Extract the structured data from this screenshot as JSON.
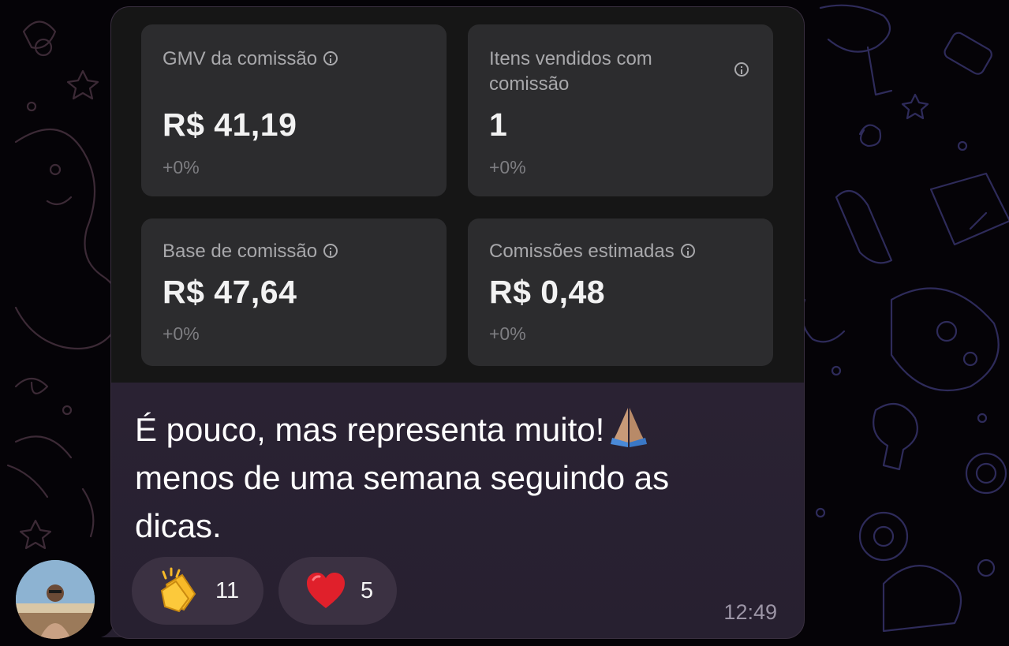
{
  "cards": [
    {
      "label": "GMV da comissão",
      "value": "R$ 41,19",
      "delta": "+0%"
    },
    {
      "label_line1": "Itens vendidos com",
      "label_line2": "comissão",
      "value": "1",
      "delta": "+0%"
    },
    {
      "label": "Base de comissão",
      "value": "R$ 47,64",
      "delta": "+0%"
    },
    {
      "label": "Comissões estimadas",
      "value": "R$ 0,48",
      "delta": "+0%"
    }
  ],
  "message": {
    "line1": "É pouco, mas representa muito!",
    "line2": "menos de uma semana seguindo as",
    "line3": "dicas.",
    "emoji": "folded-hands"
  },
  "reactions": [
    {
      "emoji": "clapping-hands",
      "count": "11"
    },
    {
      "emoji": "red-heart",
      "count": "5"
    }
  ],
  "time": "12:49",
  "colors": {
    "bubble": "#2a2233",
    "card": "#2c2c2e",
    "screenshot_bg": "#161616",
    "reaction_pill": "#3b3142",
    "heart": "#e0202b",
    "clap": "#f7b928"
  }
}
